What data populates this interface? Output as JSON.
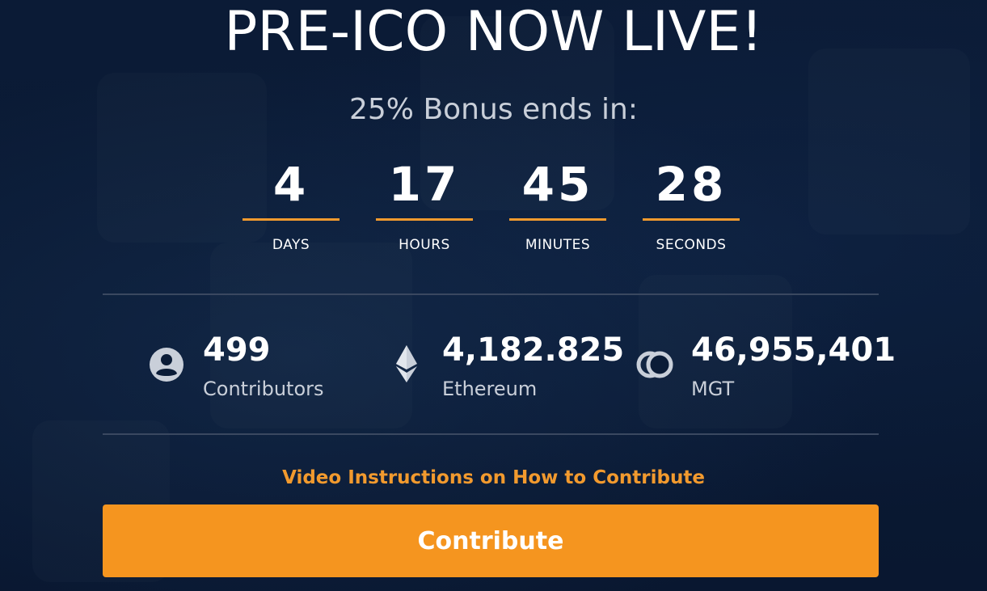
{
  "header": {
    "title": "PRE-ICO NOW LIVE!",
    "subtitle": "25% Bonus ends in:"
  },
  "countdown": {
    "units": [
      {
        "value": "4",
        "label": "DAYS"
      },
      {
        "value": "17",
        "label": "HOURS"
      },
      {
        "value": "45",
        "label": "MINUTES"
      },
      {
        "value": "28",
        "label": "SECONDS"
      }
    ]
  },
  "stats": [
    {
      "icon": "user-icon",
      "value": "499",
      "label": "Contributors"
    },
    {
      "icon": "ethereum-icon",
      "value": "4,182.825",
      "label": "Ethereum"
    },
    {
      "icon": "mgt-coin-icon",
      "value": "46,955,401",
      "label": "MGT"
    }
  ],
  "links": {
    "video_instructions": "Video Instructions on How to Contribute"
  },
  "actions": {
    "contribute_label": "Contribute"
  },
  "colors": {
    "background": "#0b1c37",
    "accent": "#f5951f",
    "divider": "#3a4860",
    "muted_text": "#c9cfd9"
  }
}
